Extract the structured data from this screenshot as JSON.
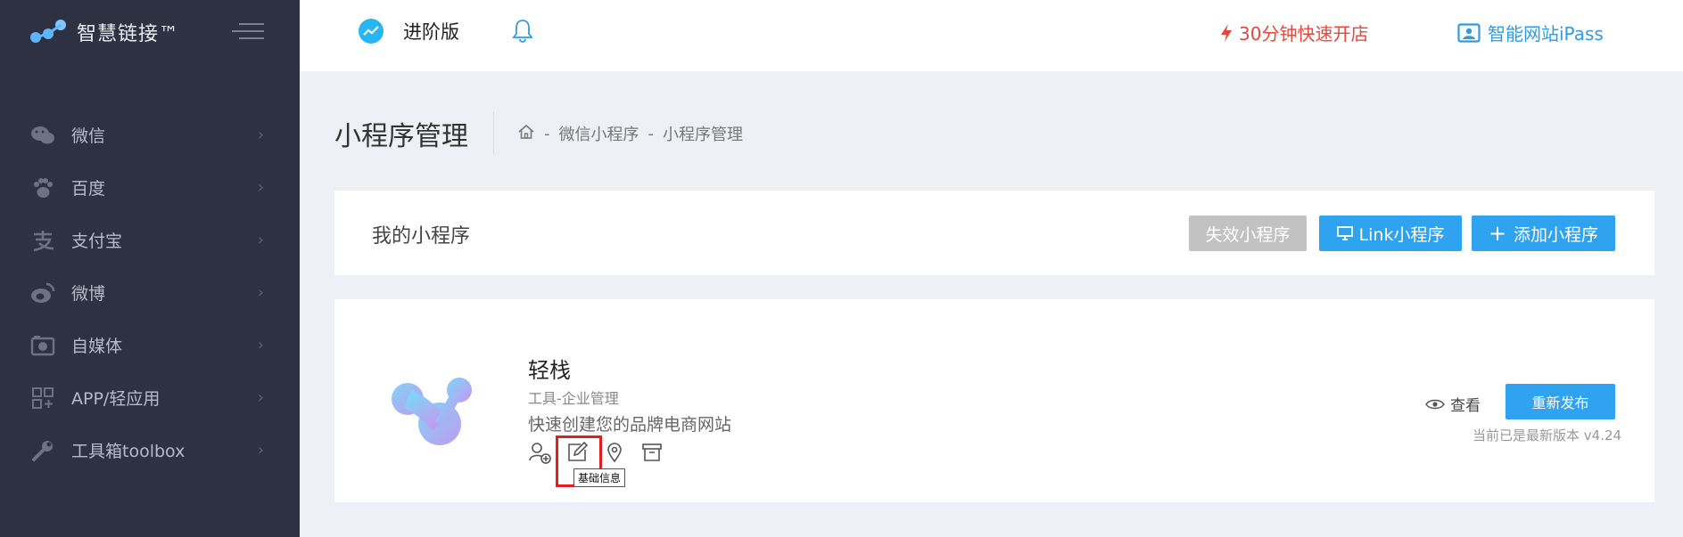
{
  "brand": {
    "name": "智慧链接™"
  },
  "sidebar": {
    "items": [
      {
        "label": "微信",
        "icon": "wechat-icon"
      },
      {
        "label": "百度",
        "icon": "paw-icon"
      },
      {
        "label": "支付宝",
        "icon": "alipay-icon"
      },
      {
        "label": "微博",
        "icon": "weibo-icon"
      },
      {
        "label": "自媒体",
        "icon": "camera-icon"
      },
      {
        "label": "APP/轻应用",
        "icon": "grid-icon"
      },
      {
        "label": "工具箱toolbox",
        "icon": "wrench-icon"
      }
    ]
  },
  "header": {
    "plan_label": "进阶版",
    "quick_open": "30分钟快速开店",
    "ipass": "智能网站iPass"
  },
  "page": {
    "title": "小程序管理",
    "breadcrumb": {
      "separator": "-",
      "level1": "微信小程序",
      "level2": "小程序管理"
    }
  },
  "my_apps": {
    "title": "我的小程序",
    "invalid_btn": "失效小程序",
    "link_btn": "Link小程序",
    "add_btn": "添加小程序"
  },
  "app": {
    "name": "轻栈",
    "category": "工具-企业管理",
    "description": "快速创建您的品牌电商网站",
    "tooltip": "基础信息",
    "view_label": "查看",
    "republish_label": "重新发布",
    "version_text": "当前已是最新版本 v4.24"
  },
  "colors": {
    "sidebar_bg": "#2e3142",
    "accent": "#2fa3ef",
    "danger": "#e5473b",
    "highlight": "#e0201e"
  }
}
